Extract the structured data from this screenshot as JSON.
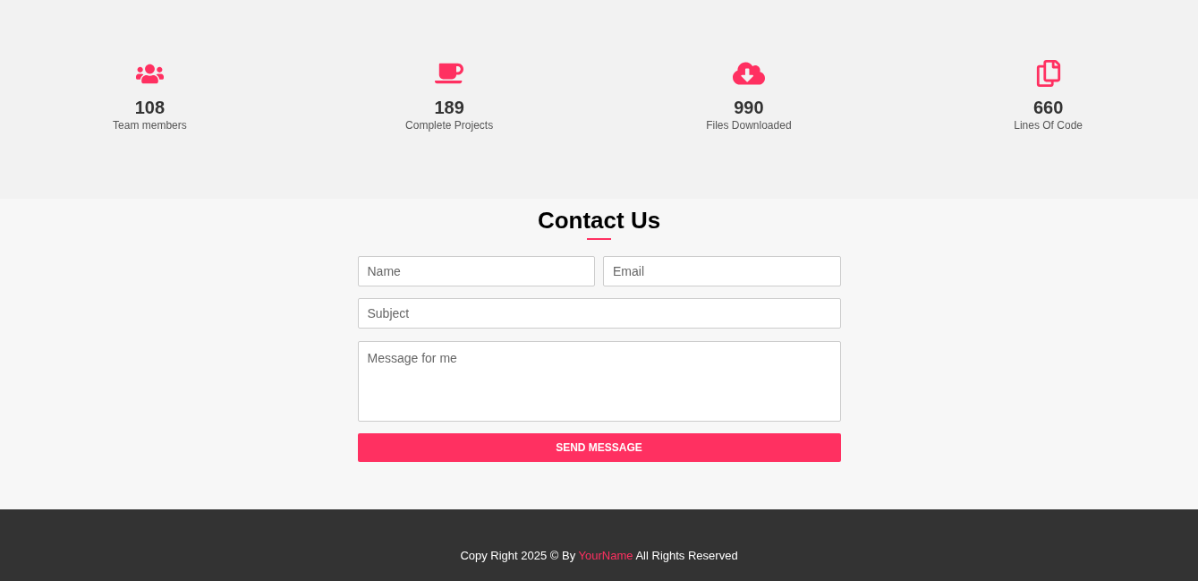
{
  "stats": [
    {
      "number": "108",
      "label": "Team members"
    },
    {
      "number": "189",
      "label": "Complete Projects"
    },
    {
      "number": "990",
      "label": "Files Downloaded"
    },
    {
      "number": "660",
      "label": "Lines Of Code"
    }
  ],
  "contact": {
    "title": "Contact Us",
    "fields": [
      {
        "placeholder": "Name"
      },
      {
        "placeholder": "Email"
      },
      {
        "placeholder": "Subject"
      },
      {
        "placeholder": "Message for me",
        "kind": "textarea"
      }
    ],
    "button": "SEND MESSAGE"
  },
  "footer": {
    "before": "Copy Right 2025 © By",
    "link": "YourName",
    "after": "All Rights Reserved"
  }
}
